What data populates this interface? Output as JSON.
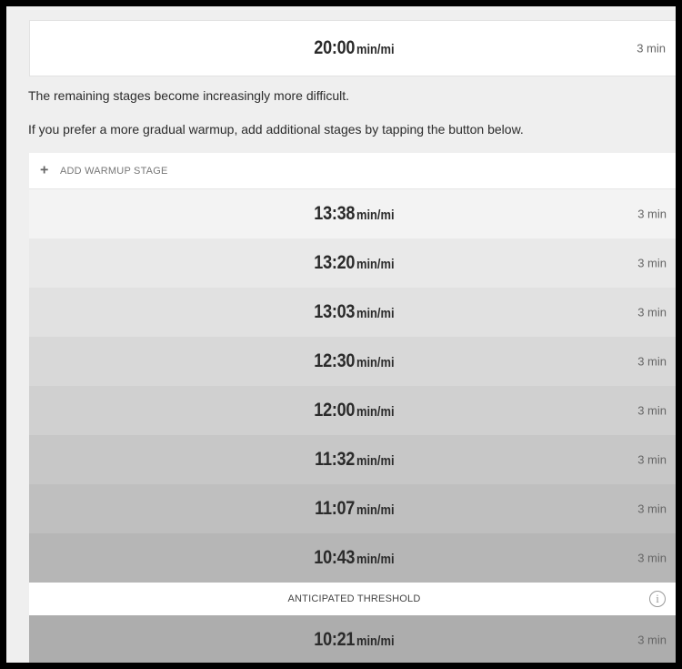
{
  "first_stage": {
    "pace": "20:00",
    "unit": "min/mi",
    "duration": "3 min"
  },
  "info_text": {
    "line1": "The remaining stages become increasingly more difficult.",
    "line2": "If you prefer a more gradual warmup, add additional stages by tapping the button below."
  },
  "add_stage": {
    "icon": "plus-icon",
    "label": "ADD WARMUP STAGE"
  },
  "stages": [
    {
      "pace": "13:38",
      "unit": "min/mi",
      "duration": "3 min",
      "color": "#f3f3f3"
    },
    {
      "pace": "13:20",
      "unit": "min/mi",
      "duration": "3 min",
      "color": "#e9e9e9"
    },
    {
      "pace": "13:03",
      "unit": "min/mi",
      "duration": "3 min",
      "color": "#e1e1e1"
    },
    {
      "pace": "12:30",
      "unit": "min/mi",
      "duration": "3 min",
      "color": "#d8d8d8"
    },
    {
      "pace": "12:00",
      "unit": "min/mi",
      "duration": "3 min",
      "color": "#d0d0d0"
    },
    {
      "pace": "11:32",
      "unit": "min/mi",
      "duration": "3 min",
      "color": "#c7c7c7"
    },
    {
      "pace": "11:07",
      "unit": "min/mi",
      "duration": "3 min",
      "color": "#bfbfbf"
    },
    {
      "pace": "10:43",
      "unit": "min/mi",
      "duration": "3 min",
      "color": "#b6b6b6"
    }
  ],
  "threshold": {
    "label": "ANTICIPATED THRESHOLD",
    "icon": "info-icon"
  },
  "threshold_stage": {
    "pace": "10:21",
    "unit": "min/mi",
    "duration": "3 min",
    "color": "#adadad"
  }
}
